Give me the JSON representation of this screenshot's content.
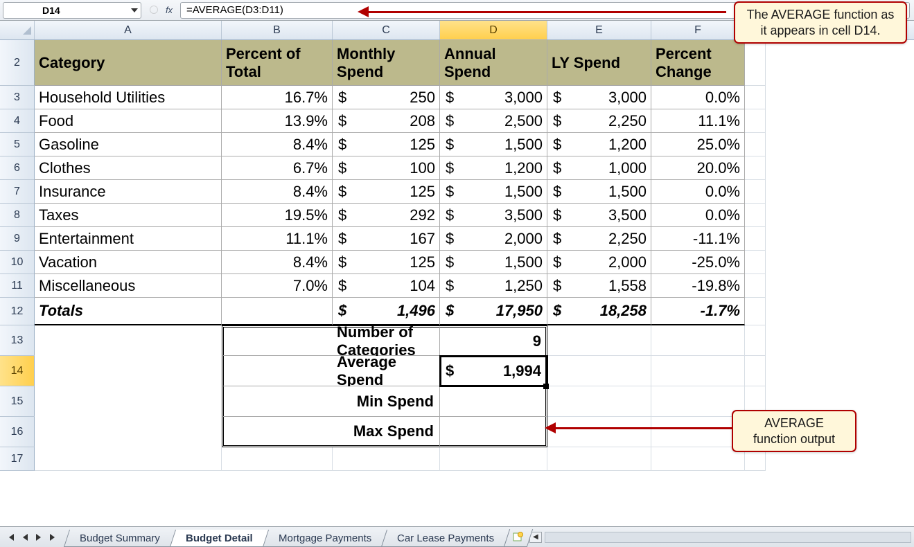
{
  "formula_bar": {
    "cell_ref": "D14",
    "formula": "=AVERAGE(D3:D11)",
    "fx_label": "fx"
  },
  "columns": [
    "A",
    "B",
    "C",
    "D",
    "E",
    "F"
  ],
  "active_column": "D",
  "rows": [
    "2",
    "3",
    "4",
    "5",
    "6",
    "7",
    "8",
    "9",
    "10",
    "11",
    "12",
    "13",
    "14",
    "15",
    "16",
    "17"
  ],
  "active_row": "14",
  "headers": {
    "A": "Category",
    "B": "Percent of Total",
    "C": "Monthly Spend",
    "D": "Annual Spend",
    "E": "LY Spend",
    "F": "Percent Change"
  },
  "data": [
    {
      "cat": "Household Utilities",
      "pct": "16.7%",
      "mon": "250",
      "ann": "3,000",
      "ly": "3,000",
      "chg": "0.0%"
    },
    {
      "cat": "Food",
      "pct": "13.9%",
      "mon": "208",
      "ann": "2,500",
      "ly": "2,250",
      "chg": "11.1%"
    },
    {
      "cat": "Gasoline",
      "pct": "8.4%",
      "mon": "125",
      "ann": "1,500",
      "ly": "1,200",
      "chg": "25.0%"
    },
    {
      "cat": "Clothes",
      "pct": "6.7%",
      "mon": "100",
      "ann": "1,200",
      "ly": "1,000",
      "chg": "20.0%"
    },
    {
      "cat": "Insurance",
      "pct": "8.4%",
      "mon": "125",
      "ann": "1,500",
      "ly": "1,500",
      "chg": "0.0%"
    },
    {
      "cat": "Taxes",
      "pct": "19.5%",
      "mon": "292",
      "ann": "3,500",
      "ly": "3,500",
      "chg": "0.0%"
    },
    {
      "cat": "Entertainment",
      "pct": "11.1%",
      "mon": "167",
      "ann": "2,000",
      "ly": "2,250",
      "chg": "-11.1%"
    },
    {
      "cat": "Vacation",
      "pct": "8.4%",
      "mon": "125",
      "ann": "1,500",
      "ly": "2,000",
      "chg": "-25.0%"
    },
    {
      "cat": "Miscellaneous",
      "pct": "7.0%",
      "mon": "104",
      "ann": "1,250",
      "ly": "1,558",
      "chg": "-19.8%"
    }
  ],
  "totals": {
    "label": "Totals",
    "mon": "1,496",
    "ann": "17,950",
    "ly": "18,258",
    "chg": "-1.7%"
  },
  "summary": [
    {
      "label": "Number of Categories",
      "value": "9",
      "is_money": false
    },
    {
      "label": "Average Spend",
      "value": "1,994",
      "is_money": true
    },
    {
      "label": "Min Spend",
      "value": "",
      "is_money": true
    },
    {
      "label": "Max Spend",
      "value": "",
      "is_money": true
    }
  ],
  "currency": "$",
  "sheet_tabs": [
    "Budget Summary",
    "Budget Detail",
    "Mortgage Payments",
    "Car Lease Payments"
  ],
  "active_sheet": "Budget Detail",
  "callouts": {
    "top": "The AVERAGE function as it appears in cell D14.",
    "mid": "AVERAGE function output"
  }
}
